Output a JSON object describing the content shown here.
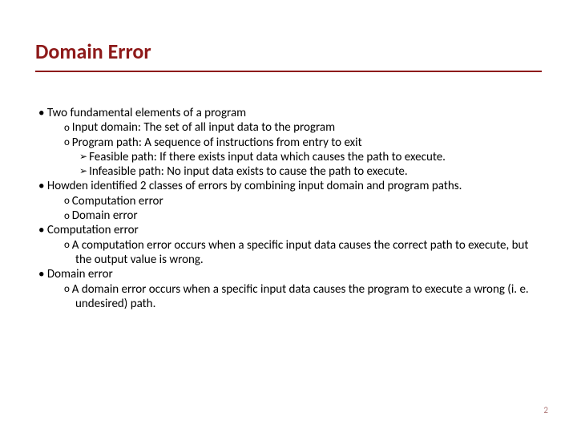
{
  "title": "Domain Error",
  "lines": {
    "l1a": "Two fundamental elements of a program",
    "l2a": "Input domain: The set of all input data to the program",
    "l2b": "Program path: A sequence of instructions from entry to exit",
    "l3a": "Feasible path: If there exists input data which causes the path to execute.",
    "l3b": "Infeasible path: No input data exists to cause the path to execute.",
    "l1b": "Howden identified 2 classes of errors by combining input domain and program paths.",
    "l2c": "Computation error",
    "l2d": "Domain error",
    "l1c": "Computation error",
    "l2e": " A computation error occurs when a specific input data causes the correct path to execute, but the output value is wrong.",
    "l1d": "Domain error",
    "l2f": "A domain error occurs when a specific input data causes the program to execute a wrong (i. e. undesired) path."
  },
  "page": "2"
}
